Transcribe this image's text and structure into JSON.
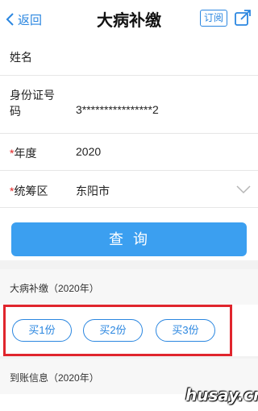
{
  "header": {
    "back_label": "返回",
    "title": "大病补缴",
    "subscribe_label": "订阅"
  },
  "form": {
    "name": {
      "label": "姓名",
      "value": ""
    },
    "id_number": {
      "label_line1": "身份证号",
      "label_line2": "码",
      "value": "3****************2"
    },
    "year": {
      "required_mark": "*",
      "label": "年度",
      "value": "2020"
    },
    "region": {
      "required_mark": "*",
      "label": "统筹区",
      "value": "东阳市"
    }
  },
  "query_button": "查询",
  "section_supplement": {
    "title": "大病补缴（2020年）",
    "buttons": [
      "买1份",
      "买2份",
      "买3份"
    ]
  },
  "section_arrival": {
    "title": "到账信息（2020年）"
  },
  "watermark": "husay.cn",
  "colors": {
    "accent": "#2a86e0",
    "primary_button": "#3b9ff0",
    "highlight_box": "#e0252d",
    "required": "#e02020"
  }
}
